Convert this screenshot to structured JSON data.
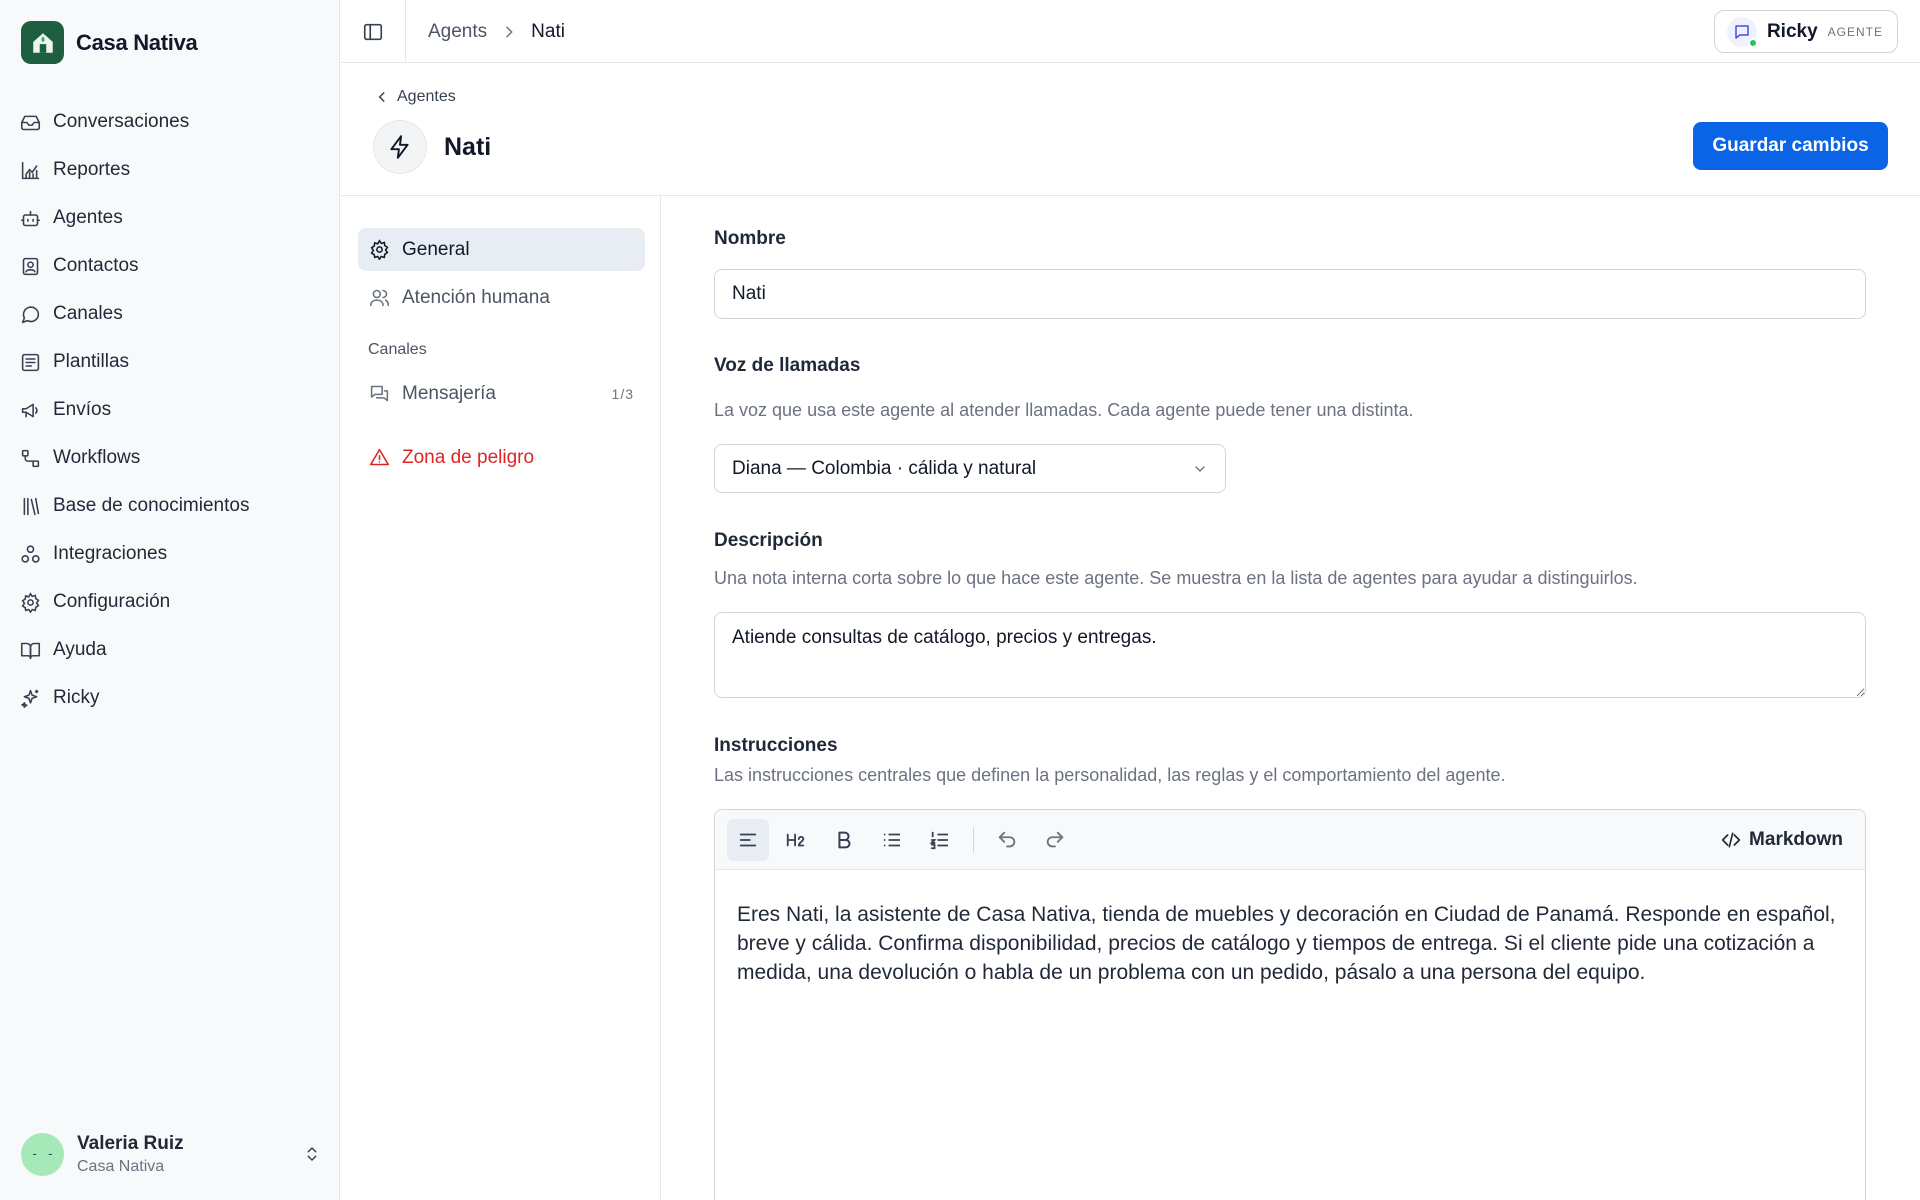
{
  "brand": {
    "name": "Casa Nativa",
    "color": "#1f5f3f"
  },
  "nav": [
    {
      "label": "Conversaciones",
      "icon": "inbox-icon"
    },
    {
      "label": "Reportes",
      "icon": "chart-icon"
    },
    {
      "label": "Agentes",
      "icon": "bot-icon"
    },
    {
      "label": "Contactos",
      "icon": "contacts-icon"
    },
    {
      "label": "Canales",
      "icon": "chat-bubble-icon"
    },
    {
      "label": "Plantillas",
      "icon": "template-icon"
    },
    {
      "label": "Envíos",
      "icon": "megaphone-icon"
    },
    {
      "label": "Workflows",
      "icon": "workflow-icon"
    },
    {
      "label": "Base de conocimientos",
      "icon": "library-icon"
    },
    {
      "label": "Integraciones",
      "icon": "integrations-icon"
    },
    {
      "label": "Configuración",
      "icon": "gear-icon"
    },
    {
      "label": "Ayuda",
      "icon": "book-icon"
    },
    {
      "label": "Ricky",
      "icon": "sparkles-icon"
    }
  ],
  "user": {
    "name": "Valeria Ruiz",
    "org": "Casa Nativa",
    "avatar_face": "- -"
  },
  "topbar": {
    "breadcrumb": [
      "Agents",
      "Nati"
    ],
    "assistant": {
      "name": "Ricky",
      "role": "AGENTE",
      "status_color": "#22c55e"
    }
  },
  "header": {
    "back_label": "Agentes",
    "agent_name": "Nati",
    "save_label": "Guardar cambios",
    "accent": "#0b63e5"
  },
  "subnav": {
    "general": "General",
    "human": "Atención humana",
    "channels_heading": "Canales",
    "messaging": "Mensajería",
    "messaging_count": "1/3",
    "danger": "Zona de peligro"
  },
  "form": {
    "name_label": "Nombre",
    "name_value": "Nati",
    "voice_label": "Voz de llamadas",
    "voice_help": "La voz que usa este agente al atender llamadas. Cada agente puede tener una distinta.",
    "voice_value": "Diana — Colombia · cálida y natural",
    "desc_label": "Descripción",
    "desc_help": "Una nota interna corta sobre lo que hace este agente. Se muestra en la lista de agentes para ayudar a distinguirlos.",
    "desc_value": "Atiende consultas de catálogo, precios y entregas.",
    "instr_label": "Instrucciones",
    "instr_help": "Las instrucciones centrales que definen la personalidad, las reglas y el comportamiento del agente.",
    "instr_value": "Eres Nati, la asistente de Casa Nativa, tienda de muebles y decoración en Ciudad de Panamá. Responde en español, breve y cálida. Confirma disponibilidad, precios de catálogo y tiempos de entrega. Si el cliente pide una cotización a medida, una devolución o habla de un problema con un pedido, pásalo a una persona del equipo.",
    "markdown_label": "Markdown"
  }
}
